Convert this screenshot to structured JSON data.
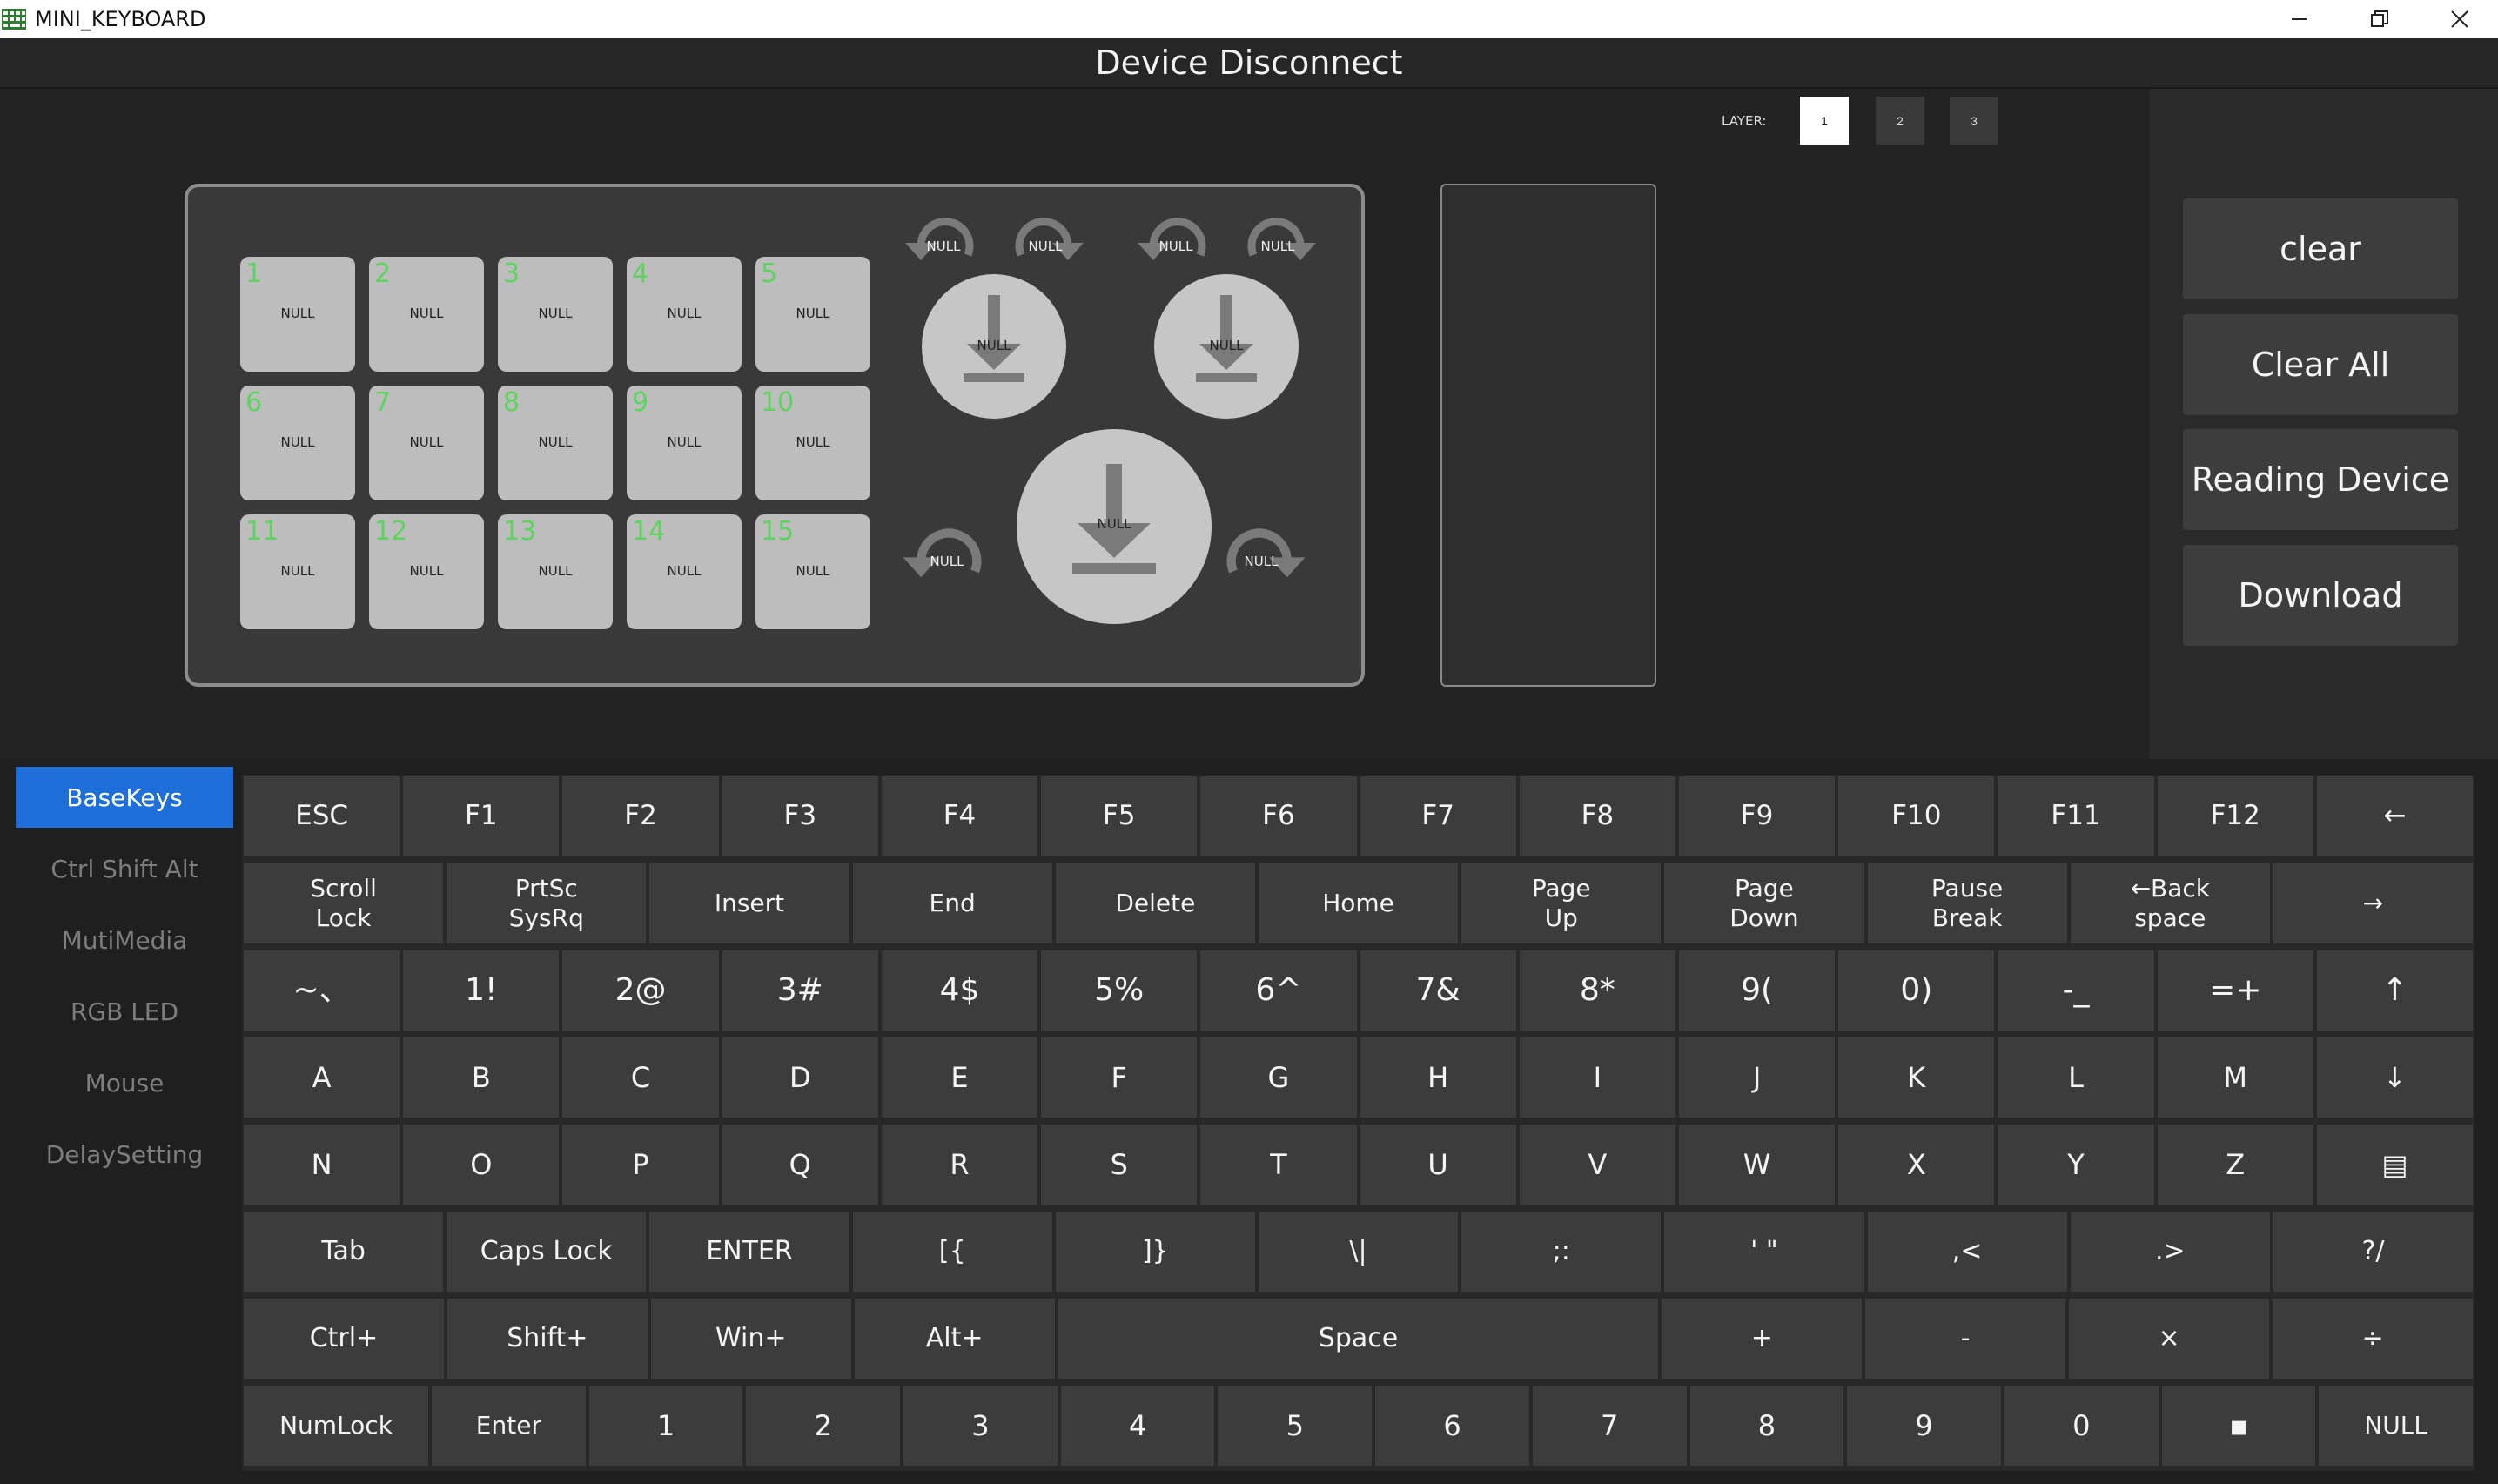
{
  "window": {
    "title": "MINI_KEYBOARD"
  },
  "status": {
    "text": "Device Disconnect"
  },
  "layers": {
    "label": "LAYER:",
    "buttons": [
      "1",
      "2",
      "3"
    ],
    "active": 0
  },
  "device": {
    "keys": [
      {
        "num": "1",
        "value": "NULL"
      },
      {
        "num": "2",
        "value": "NULL"
      },
      {
        "num": "3",
        "value": "NULL"
      },
      {
        "num": "4",
        "value": "NULL"
      },
      {
        "num": "5",
        "value": "NULL"
      },
      {
        "num": "6",
        "value": "NULL"
      },
      {
        "num": "7",
        "value": "NULL"
      },
      {
        "num": "8",
        "value": "NULL"
      },
      {
        "num": "9",
        "value": "NULL"
      },
      {
        "num": "10",
        "value": "NULL"
      },
      {
        "num": "11",
        "value": "NULL"
      },
      {
        "num": "12",
        "value": "NULL"
      },
      {
        "num": "13",
        "value": "NULL"
      },
      {
        "num": "14",
        "value": "NULL"
      },
      {
        "num": "15",
        "value": "NULL"
      }
    ],
    "knobs": [
      {
        "press": "NULL",
        "ccw": "NULL",
        "cw": "NULL"
      },
      {
        "press": "NULL",
        "ccw": "NULL",
        "cw": "NULL"
      },
      {
        "press": "NULL",
        "ccw": "NULL",
        "cw": "NULL"
      }
    ]
  },
  "actions": {
    "clear": "clear",
    "clear_all": "Clear All",
    "reading_device": "Reading Device",
    "download": "Download"
  },
  "categories": [
    "BaseKeys",
    "Ctrl Shift Alt",
    "MutiMedia",
    "RGB LED",
    "Mouse",
    "DelaySetting"
  ],
  "active_category": 0,
  "keyboard": {
    "rows": [
      [
        "ESC",
        "F1",
        "F2",
        "F3",
        "F4",
        "F5",
        "F6",
        "F7",
        "F8",
        "F9",
        "F10",
        "F11",
        "F12",
        "←"
      ],
      [
        "Scroll\nLock",
        "PrtSc\nSysRq",
        "Insert",
        "End",
        "Delete",
        "Home",
        "Page\nUp",
        "Page\nDown",
        "Pause\nBreak",
        "←Back\nspace",
        "→"
      ],
      [
        "~、",
        "1!",
        "2@",
        "3#",
        "4$",
        "5%",
        "6^",
        "7&",
        "8*",
        "9(",
        "0)",
        "-_",
        "=+",
        "↑"
      ],
      [
        "A",
        "B",
        "C",
        "D",
        "E",
        "F",
        "G",
        "H",
        "I",
        "J",
        "K",
        "L",
        "M",
        "↓"
      ],
      [
        "N",
        "O",
        "P",
        "Q",
        "R",
        "S",
        "T",
        "U",
        "V",
        "W",
        "X",
        "Y",
        "Z",
        "▤"
      ],
      [
        "Tab",
        "Caps Lock",
        "ENTER",
        "[{",
        "]}",
        "\\|",
        ";:",
        "' \"",
        ",<",
        ".>",
        "?/"
      ],
      [
        "Ctrl+",
        "Shift+",
        "Win+",
        "Alt+",
        "Space",
        "+",
        "-",
        "×",
        "÷"
      ],
      [
        "NumLock",
        "Enter",
        "1",
        "2",
        "3",
        "4",
        "5",
        "6",
        "7",
        "8",
        "9",
        "0",
        "▪",
        "NULL"
      ]
    ]
  },
  "colors": {
    "accent": "#1e6fd9",
    "key_number": "#5fd35f",
    "background": "#222222",
    "key_face": "#3c3c3c"
  },
  "icons": [
    "app-icon",
    "minimize-icon",
    "restore-icon",
    "close-icon",
    "down-arrow-icon",
    "rotate-ccw-icon",
    "rotate-cw-icon",
    "menu-key-icon"
  ]
}
